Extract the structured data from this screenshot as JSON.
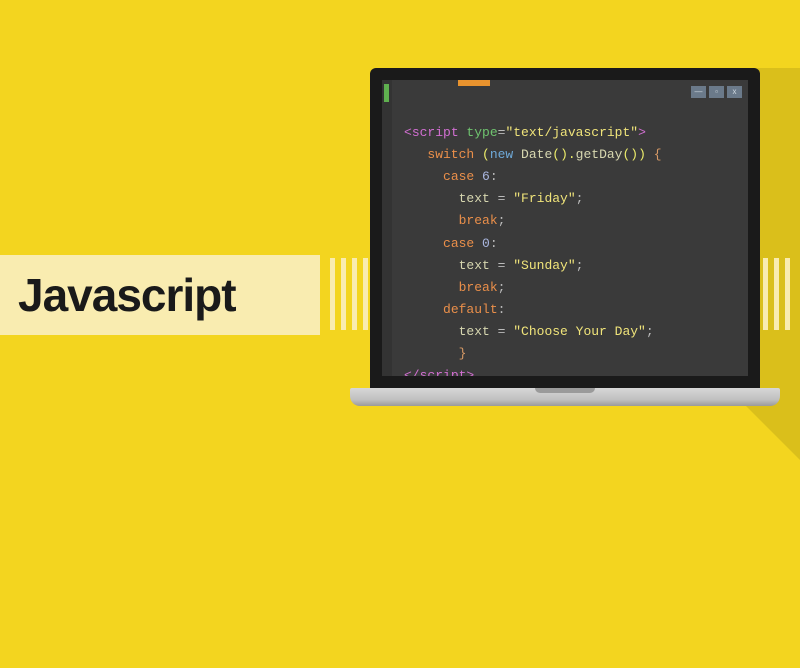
{
  "banner": {
    "title": "Javascript"
  },
  "code": {
    "l1_open": "<",
    "l1_tag": "script",
    "l1_attr": " type",
    "l1_eq": "=",
    "l1_str": "\"text/javascript\"",
    "l1_close": ">",
    "l2_kw": "switch",
    "l2_sp": " (",
    "l2_new": "new",
    "l2_sp2": " ",
    "l2_fn": "Date",
    "l2_p1": "().",
    "l2_fn2": "getDay",
    "l2_p2": "()) ",
    "l2_brace": "{",
    "l3_kw": "case",
    "l3_sp": " ",
    "l3_num": "6",
    "l3_colon": ":",
    "l4_var": "text",
    "l4_eq": " = ",
    "l4_str": "\"Friday\"",
    "l4_semi": ";",
    "l5_kw": "break",
    "l5_semi": ";",
    "l6_kw": "case",
    "l6_sp": " ",
    "l6_num": "0",
    "l6_colon": ":",
    "l7_var": "text",
    "l7_eq": " = ",
    "l7_str": "\"Sunday\"",
    "l7_semi": ";",
    "l8_kw": "break",
    "l8_semi": ";",
    "l9_kw": "default",
    "l9_colon": ":",
    "l10_var": "text",
    "l10_eq": " = ",
    "l10_str": "\"Choose Your Day\"",
    "l10_semi": ";",
    "l11_brace": "}",
    "l12_open": "</",
    "l12_tag": "script",
    "l12_close": ">"
  },
  "window": {
    "min": "—",
    "max": "▫",
    "close": "x"
  }
}
